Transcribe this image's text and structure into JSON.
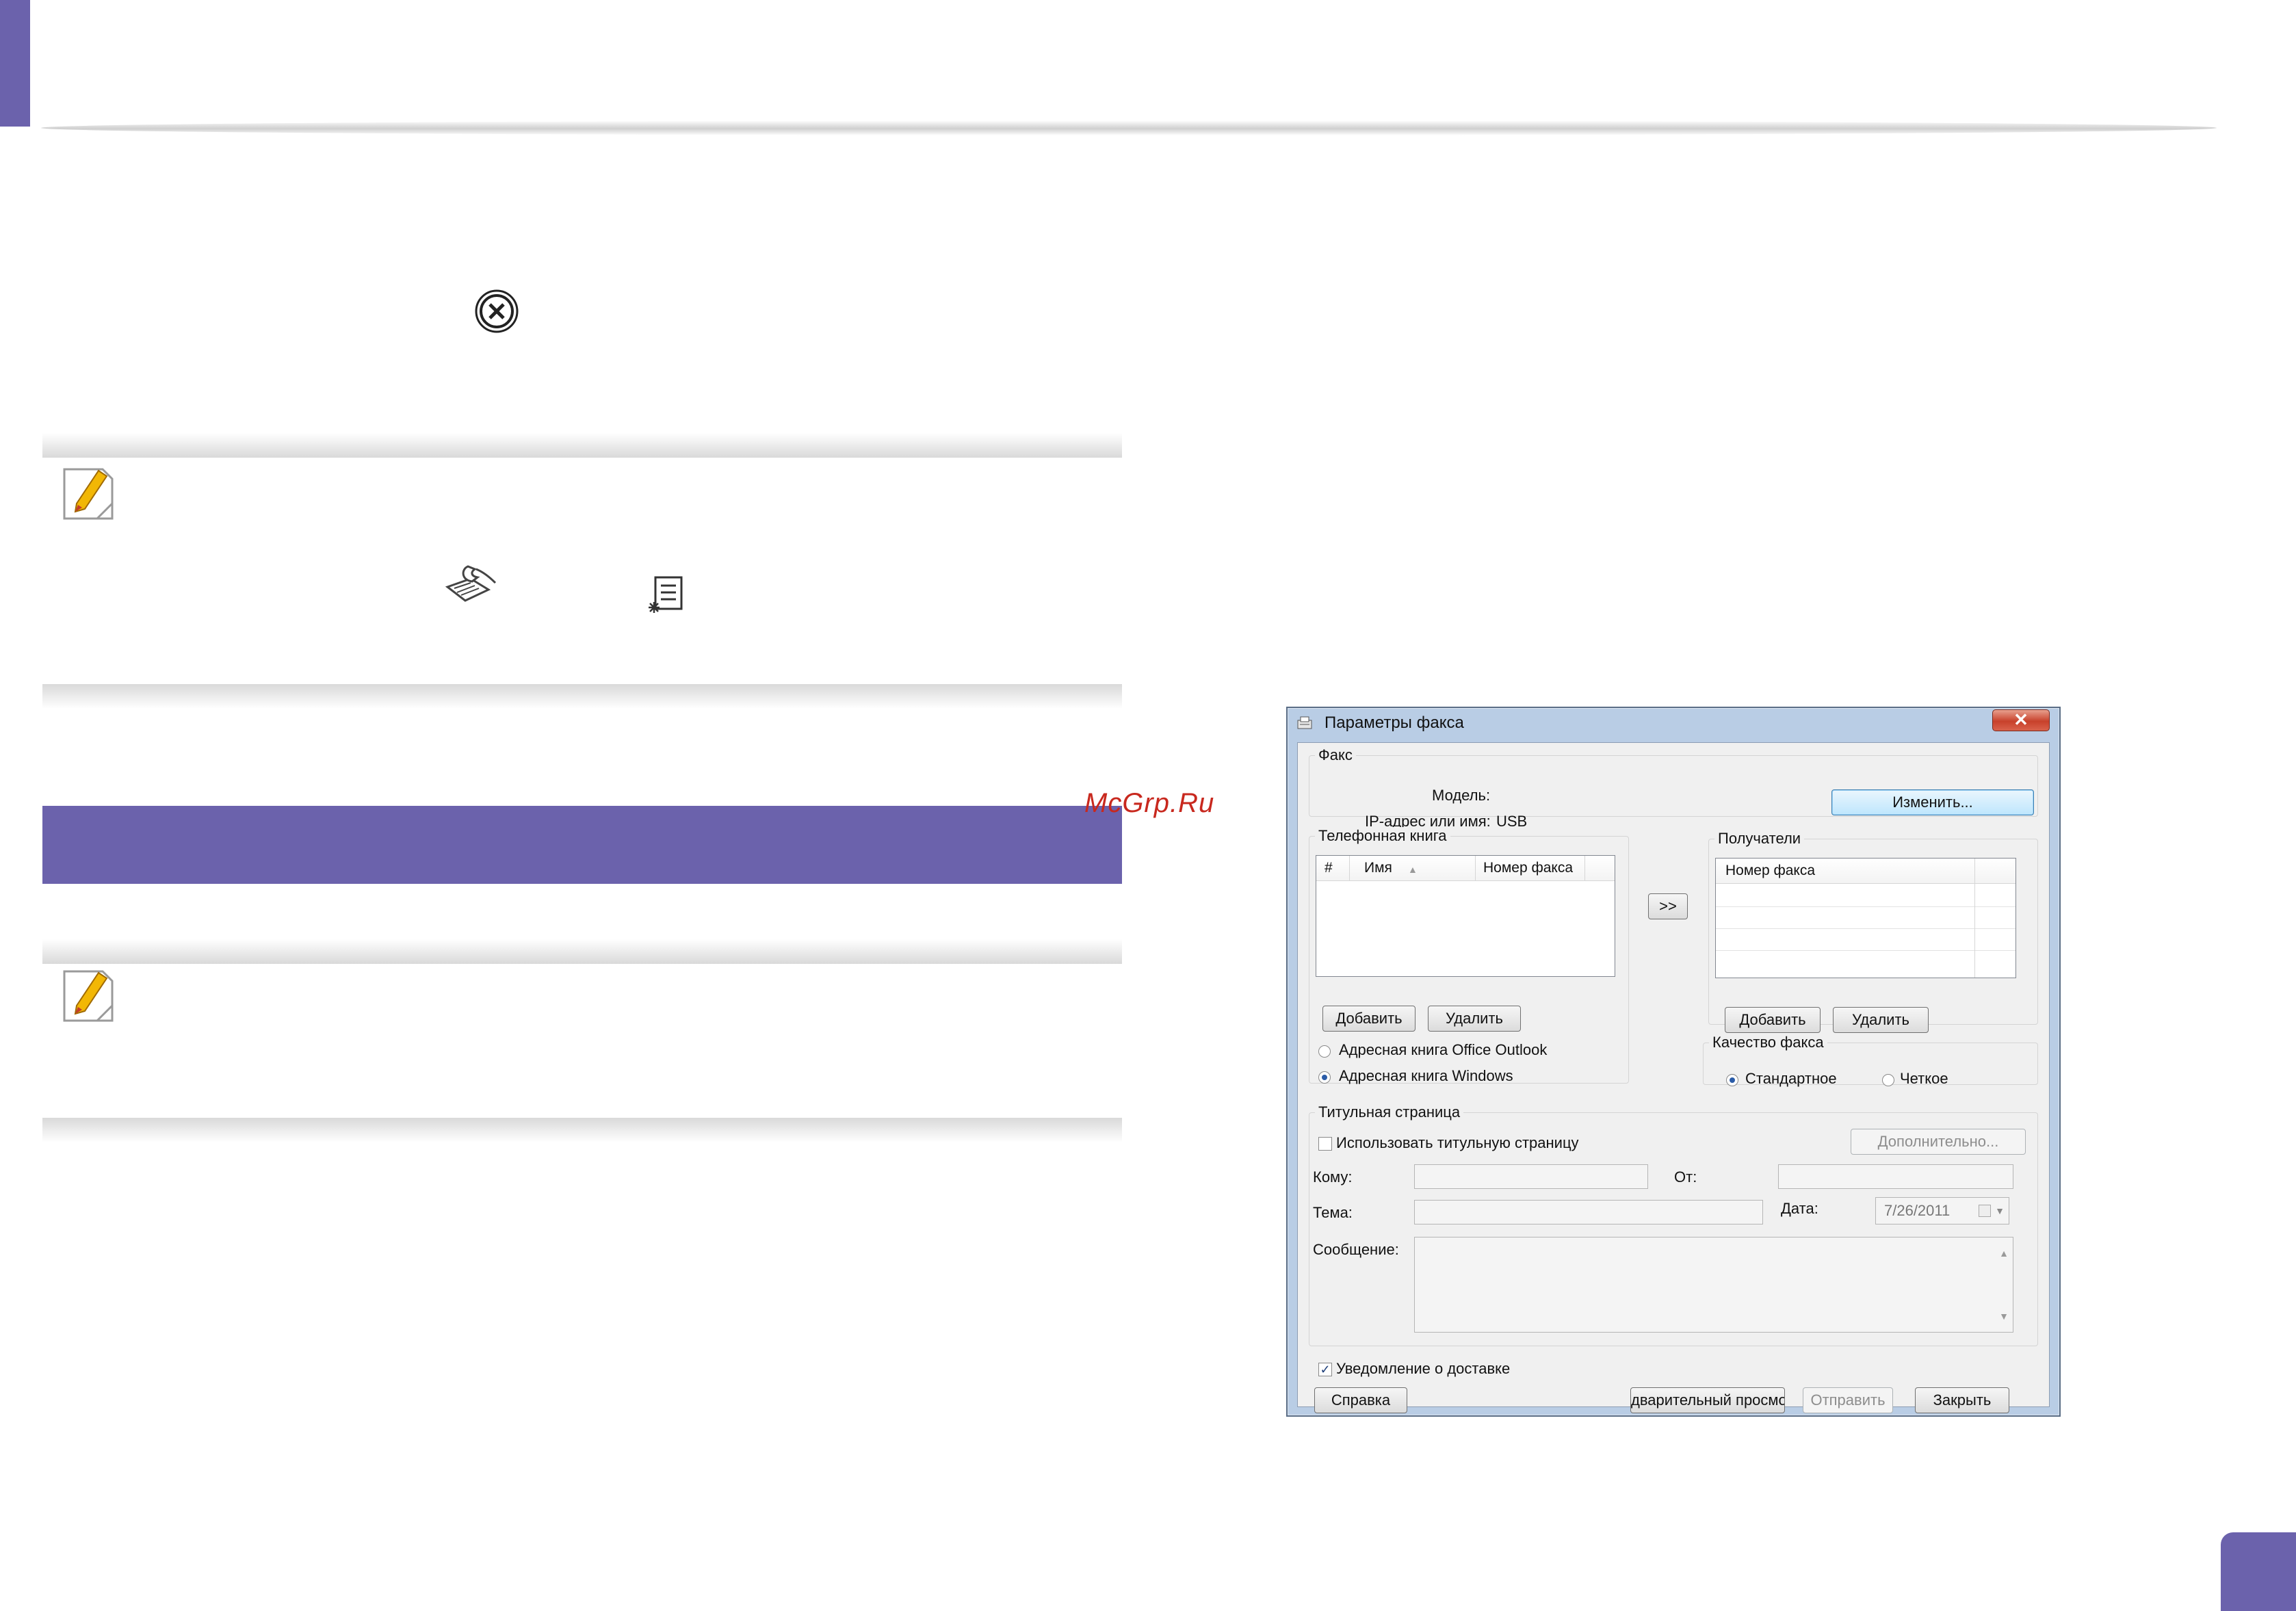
{
  "watermark": "McGrp.Ru",
  "dialog": {
    "title": "Параметры факса",
    "close_glyph": "✕",
    "fax_group": {
      "title": "Факс",
      "model_label": "Модель:",
      "model_value": "",
      "ip_label": "IP-адрес или имя:",
      "ip_value": "USB",
      "change_button": "Изменить..."
    },
    "phonebook": {
      "title": "Телефонная книга",
      "columns": [
        "#",
        "Имя",
        "Номер факса"
      ],
      "sort_glyph": "▲",
      "add_button": "Добавить",
      "delete_button": "Удалить",
      "radio_outlook": "Адресная книга Office Outlook",
      "radio_windows": "Адресная книга Windows",
      "selected": "windows"
    },
    "transfer_button": ">>",
    "recipients": {
      "title": "Получатели",
      "column": "Номер факса",
      "add_button": "Добавить",
      "delete_button": "Удалить"
    },
    "quality": {
      "title": "Качество факса",
      "standard": "Стандартное",
      "fine": "Четкое",
      "selected": "standard"
    },
    "cover": {
      "title": "Титульная страница",
      "use_cover_label": "Использовать титульную страницу",
      "use_cover_checked": false,
      "advanced_button": "Дополнительно...",
      "to_label": "Кому:",
      "from_label": "От:",
      "subject_label": "Тема:",
      "date_label": "Дата:",
      "date_value": "7/26/2011",
      "message_label": "Сообщение:"
    },
    "delivery_notice_label": "Уведомление о доставке",
    "delivery_notice_checked": true,
    "check_glyph": "✓",
    "help_button": "Справка",
    "preview_button": "дварительный просмо",
    "send_button": "Отправить",
    "close_button": "Закрыть"
  }
}
